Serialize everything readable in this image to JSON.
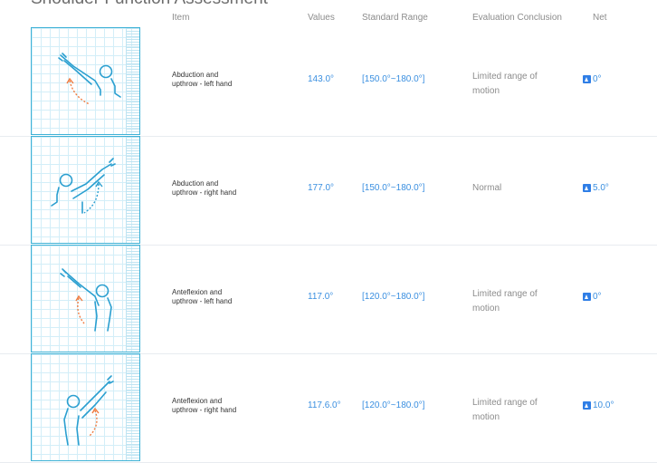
{
  "title": "Shoulder Function Assessment",
  "columns": {
    "item": "Item",
    "values": "Values",
    "range": "Standard Range",
    "evaluation": "Evaluation Conclusion",
    "net": "Net"
  },
  "rows": [
    {
      "item_line1": "Abduction and",
      "item_line2": "upthrow - left hand",
      "value": "143.0°",
      "range": "[150.0°~180.0°]",
      "eval_line1": "Limited range of",
      "eval_line2": "motion",
      "net": "0°",
      "icon": "abduction-left-figure-icon"
    },
    {
      "item_line1": "Abduction and",
      "item_line2": "upthrow - right hand",
      "value": "177.0°",
      "range": "[150.0°~180.0°]",
      "eval_line1": "Normal",
      "eval_line2": "",
      "net": "5.0°",
      "icon": "abduction-right-figure-icon"
    },
    {
      "item_line1": "Anteflexion and",
      "item_line2": "upthrow - left hand",
      "value": "117.0°",
      "range": "[120.0°~180.0°]",
      "eval_line1": "Limited range of",
      "eval_line2": "motion",
      "net": "0°",
      "icon": "anteflexion-left-figure-icon"
    },
    {
      "item_line1": "Anteflexion and",
      "item_line2": "upthrow - right hand",
      "value": "117.6.0°",
      "range": "[120.0°~180.0°]",
      "eval_line1": "Limited range of",
      "eval_line2": "motion",
      "net": "10.0°",
      "icon": "anteflexion-right-figure-icon"
    }
  ],
  "colors": {
    "accent": "#3a8fe0",
    "grid_border": "#3fb2d6",
    "arrow": "#f07b3f"
  }
}
